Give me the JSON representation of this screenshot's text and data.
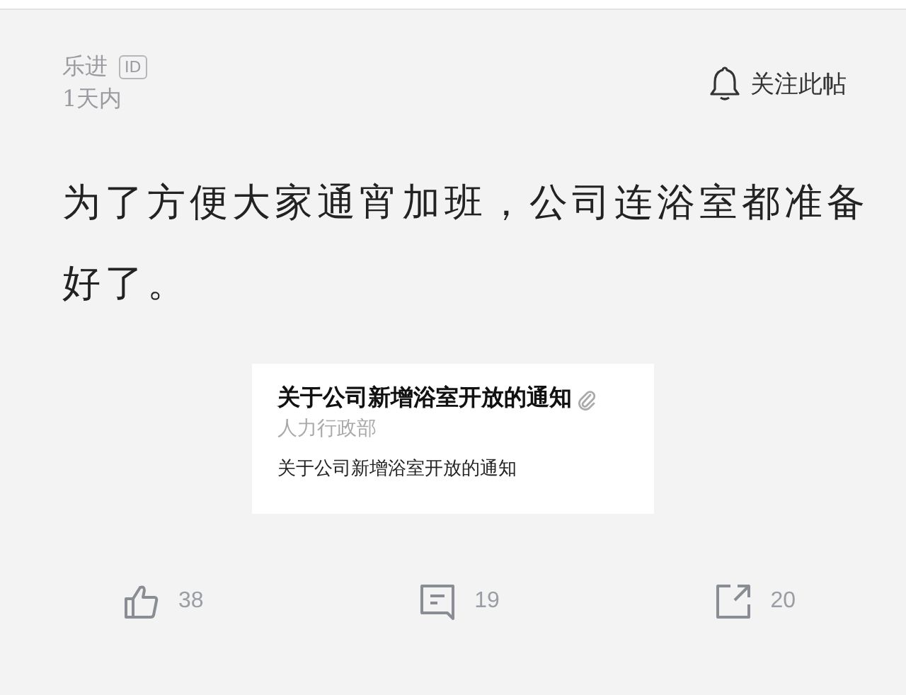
{
  "post": {
    "author": "乐进",
    "author_badge": "ID",
    "time": "1天内",
    "follow_label": "关注此帖",
    "text": "为了方便大家通宵加班，公司连浴室都准备好了。"
  },
  "attachment": {
    "title": "关于公司新增浴室开放的通知",
    "department": "人力行政部",
    "body": "关于公司新增浴室开放的通知"
  },
  "actions": [
    {
      "kind": "like",
      "count": "38"
    },
    {
      "kind": "comment",
      "count": "19"
    },
    {
      "kind": "share",
      "count": "20"
    }
  ]
}
